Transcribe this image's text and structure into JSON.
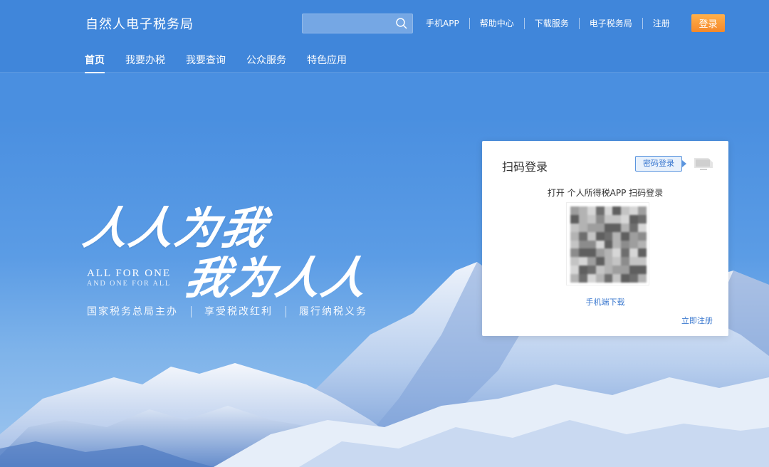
{
  "header": {
    "brand": "自然人电子税务局",
    "search_placeholder": "",
    "links": [
      "手机APP",
      "帮助中心",
      "下载服务",
      "电子税务局",
      "注册"
    ],
    "login_label": "登录"
  },
  "nav": {
    "items": [
      "首页",
      "我要办税",
      "我要查询",
      "公众服务",
      "特色应用"
    ],
    "active": 0
  },
  "hero": {
    "slogan_line1": "人人为我",
    "slogan_line2": "我为人人",
    "slogan_en_main": "ALL FOR ONE",
    "slogan_en_sub": "AND ONE FOR ALL",
    "motto": [
      "国家税务总局主办",
      "享受税改红利",
      "履行纳税义务"
    ]
  },
  "login_panel": {
    "title": "扫码登录",
    "password_login": "密码登录",
    "qr_hint": "打开 个人所得税APP 扫码登录",
    "app_download": "手机端下载",
    "register_now": "立即注册"
  },
  "colors": {
    "accent": "#3a78cf",
    "login_button": "#f5892b",
    "header_bg": "#3880d6"
  },
  "icons": {
    "search": "search-icon",
    "pc_switch": "desktop-icon"
  }
}
